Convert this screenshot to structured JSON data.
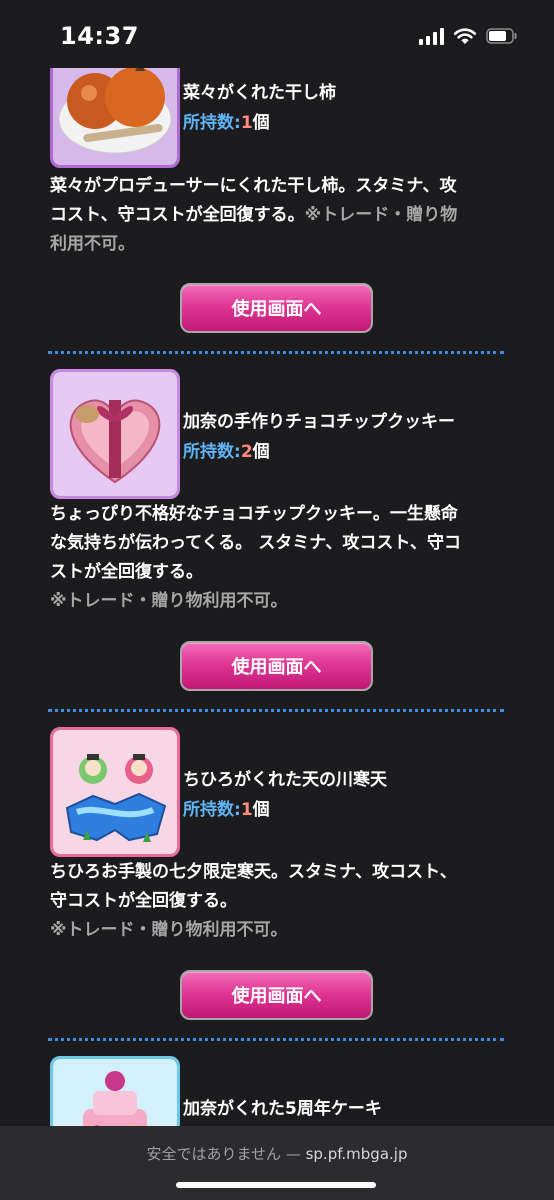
{
  "status_bar": {
    "time": "14:37",
    "icons": [
      "cellular-signal-icon",
      "wifi-icon",
      "battery-icon"
    ]
  },
  "items": [
    {
      "name": "菜々がくれた干し柿",
      "count_label": "所持数:",
      "count": "1",
      "count_unit": "個",
      "desc_lines": [
        "菜々がプロデューサーにくれた干し柿。スタミナ、攻",
        "コスト、守コストが全回復する。"
      ],
      "note": "※トレード・贈り物",
      "note_line2": "利用不可。",
      "button_label": "使用画面へ"
    },
    {
      "name": "加奈の手作りチョコチップクッキー",
      "count_label": "所持数:",
      "count": "2",
      "count_unit": "個",
      "desc_lines": [
        "ちょっぴり不格好なチョコチップクッキー。一生懸命",
        "な気持ちが伝わってくる。 スタミナ、攻コスト、守コ",
        "ストが全回復する。"
      ],
      "note": "※トレード・贈り物利用不可。",
      "button_label": "使用画面へ"
    },
    {
      "name": "ちひろがくれた天の川寒天",
      "count_label": "所持数:",
      "count": "1",
      "count_unit": "個",
      "desc_lines": [
        "ちひろお手製の七夕限定寒天。スタミナ、攻コスト、",
        "守コストが全回復する。"
      ],
      "note": "※トレード・贈り物利用不可。",
      "button_label": "使用画面へ"
    },
    {
      "name": "加奈がくれた5周年ケーキ"
    }
  ],
  "url_bar": {
    "warning": "安全ではありません — ",
    "domain": "sp.pf.mbga.jp"
  },
  "colors": {
    "accent_pink": "#e03894",
    "count_label": "#5fb4f5",
    "count_value": "#ff8a80",
    "divider": "#3b8ee6"
  }
}
